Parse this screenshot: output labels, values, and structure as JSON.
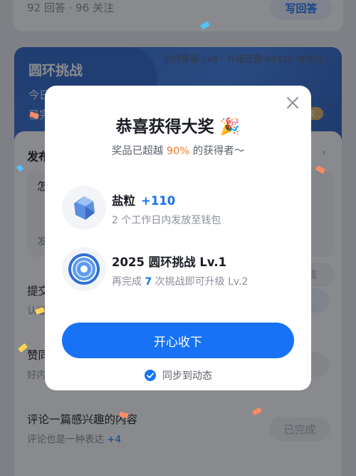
{
  "background": {
    "stats_text": "92 回答 · 96 关注",
    "write_answer_button": "写回答",
    "challenge": {
      "meta": "创作等级 Lv8 · 升级还需 84316 创作分 ›",
      "title": "圆环挑战",
      "line1": "今日",
      "line2": "已完",
      "reward_badge": "权"
    },
    "task_section": {
      "title": "发布",
      "right_hint": "› ",
      "inner_question": "怎",
      "inner_answer": "发"
    },
    "tasks": [
      {
        "title": "提交",
        "desc": "认证"
      },
      {
        "title": "赞同",
        "desc": "好内"
      },
      {
        "title": "评论一篇感兴趣的内容",
        "desc": "评论也是一种表达",
        "bonus": "+4"
      }
    ],
    "ghost_button_label": "成",
    "completed_button": "已完成"
  },
  "modal": {
    "title": "恭喜获得大奖 🎉",
    "subtitle_prefix": "奖品已超越 ",
    "subtitle_pct": "90%",
    "subtitle_suffix": " 的获得者～",
    "rewards": [
      {
        "name": "盐粒",
        "amount": "+110",
        "desc": "2 个工作日内发放至钱包",
        "icon": "salt-crystal-icon"
      },
      {
        "name": "2025 圆环挑战 Lv.1",
        "desc_prefix": "再完成 ",
        "desc_num": "7",
        "desc_suffix": " 次挑战即可升级 Lv.2",
        "icon": "ring-badge-icon"
      }
    ],
    "confirm_button": "开心收下",
    "sync_label": "同步到动态"
  },
  "colors": {
    "primary": "#1772f6",
    "highlight_orange": "#f07a24",
    "overlay": "rgba(20,22,28,0.50)"
  }
}
